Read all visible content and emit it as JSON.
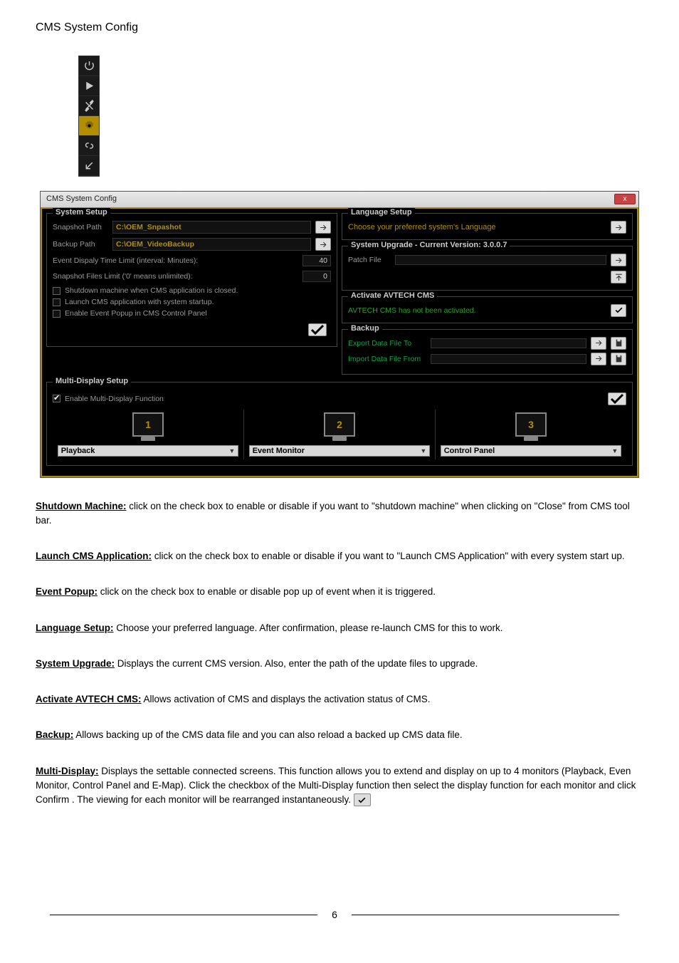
{
  "page_header": "CMS System Config",
  "toolbar_icons": [
    "power-icon",
    "play-icon",
    "tools-icon",
    "gear-icon",
    "chain-icon",
    "arrow-down-left-icon"
  ],
  "window": {
    "title": "CMS System Config",
    "close_label": "x"
  },
  "system_setup": {
    "legend": "System Setup",
    "snapshot_path_label": "Snapshot Path",
    "snapshot_path_value": "C:\\OEM_Snpashot",
    "backup_path_label": "Backup Path",
    "backup_path_value": "C:\\OEM_VideoBackup",
    "event_time_label": "Event Dispaly Time Limit (interval: Minutes):",
    "event_time_value": "40",
    "files_limit_label": "Snapshot Files Limit ('0' means unlimited):",
    "files_limit_value": "0",
    "chk_shutdown": "Shutdown machine when CMS application is closed.",
    "chk_launch": "Launch CMS application with system startup.",
    "chk_popup": "Enable Event Popup in CMS Control Panel"
  },
  "language_setup": {
    "legend": "Language Setup",
    "text": "Choose your preferred system's Language"
  },
  "system_upgrade": {
    "legend": "System Upgrade - Current Version: 3.0.0.7",
    "patch_label": "Patch File"
  },
  "activate": {
    "legend": "Activate AVTECH CMS",
    "text": "AVTECH CMS has not been activated."
  },
  "backup": {
    "legend": "Backup",
    "export_label": "Export Data File To",
    "import_label": "Import Data File From"
  },
  "multi_display": {
    "legend": "Multi-Display Setup",
    "enable_label": "Enable Multi-Display Function",
    "monitors": [
      {
        "num": "1",
        "select": "Playback"
      },
      {
        "num": "2",
        "select": "Event Monitor"
      },
      {
        "num": "3",
        "select": "Control Panel"
      }
    ]
  },
  "description": {
    "shutdown_label": "Shutdown Machine:",
    "shutdown_text": " click on the check box to enable or disable if you want to \"shutdown machine\" when clicking on \"Close\" from CMS tool bar.",
    "launch_label": "Launch CMS Application:",
    "launch_text": " click on the check box to enable or disable if you want to \"Launch CMS Application\" with every system start up.",
    "event_popup_label": "Event Popup:",
    "event_popup_text": " click on the check box to enable or disable pop up of event when it is triggered.",
    "language_label": "Language Setup:",
    "language_text": " Choose your preferred language. After confirmation, please re-launch CMS for this to work.",
    "upgrade_label": "System Upgrade:",
    "upgrade_text": " Displays the current CMS version. Also, enter the path of the update files to upgrade.",
    "activate_label": "Activate AVTECH CMS:",
    "activate_text": " Allows activation of CMS and displays the activation status of CMS.",
    "backup_label": "Backup:",
    "backup_text": " Allows backing up of the CMS data file and you can also reload a backed up CMS data file.",
    "multi_label": "Multi-Display:",
    "multi_text": " Displays the settable connected screens. This function allows you to extend and display on up to 4 monitors (Playback, Even Monitor, Control Panel and E-Map). Click the checkbox of the Multi-Display function then select the display function for each monitor and click Confirm         . The viewing for each monitor will be rearranged instantaneously."
  },
  "footer": {
    "page": "6"
  }
}
